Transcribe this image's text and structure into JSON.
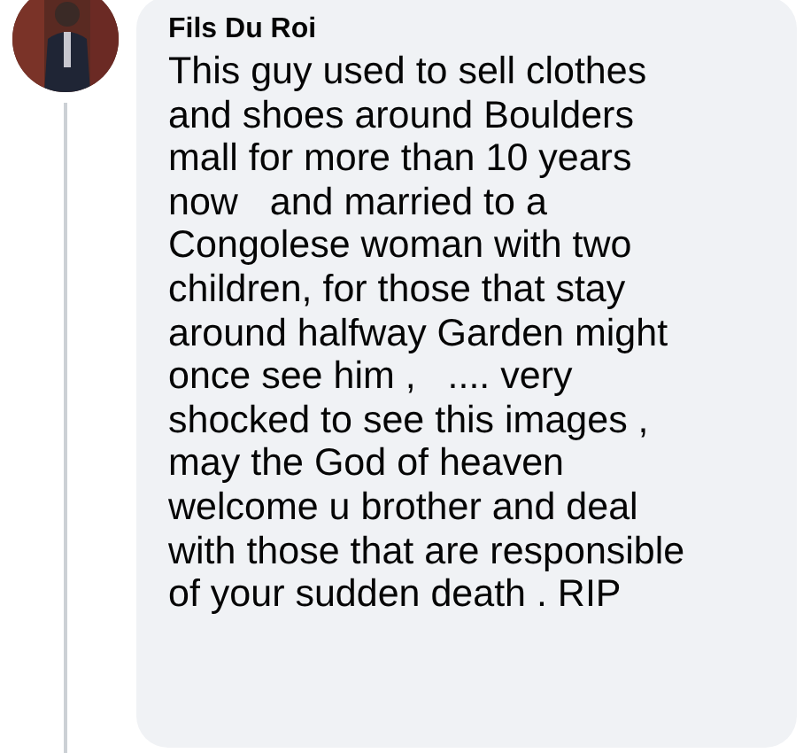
{
  "comment": {
    "author": "Fils Du Roi",
    "text": "This guy used to sell clothes\nand shoes around Boulders\nmall for more than 10 years\nnow   and married to a\nCongolese woman with two\nchildren, for those that stay\naround halfway Garden might\nonce see him ,   .... very\nshocked to see this images ,\nmay the God of heaven\nwelcome u brother and deal\nwith those that are responsible\nof your sudden death . RIP"
  }
}
